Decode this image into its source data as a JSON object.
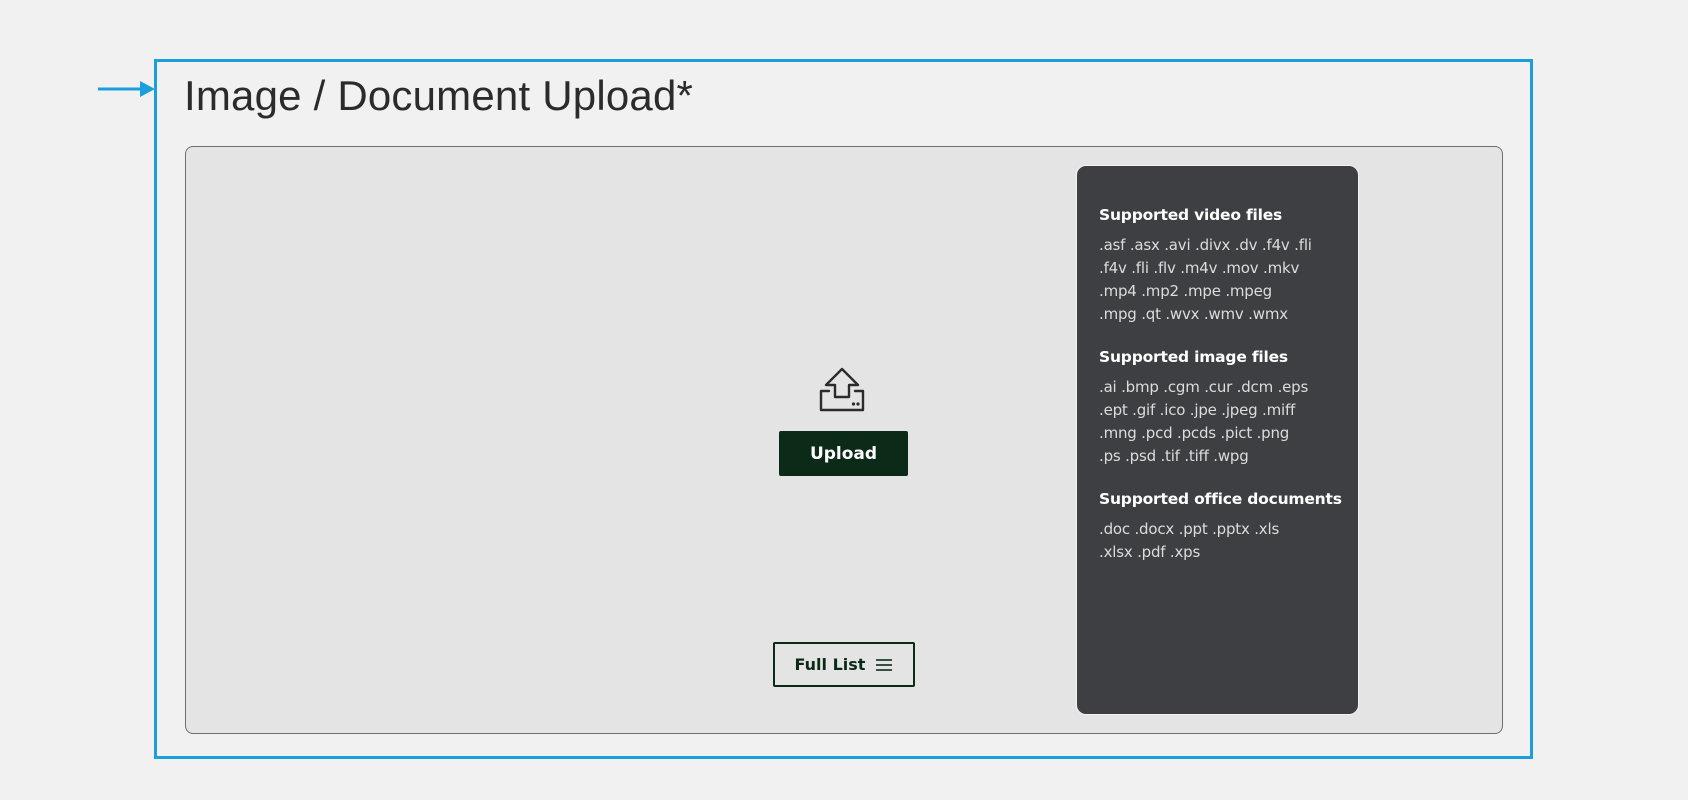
{
  "title": "Image / Document Upload*",
  "upload": {
    "button_label": "Upload",
    "icon": "upload-tray-icon"
  },
  "full_list": {
    "button_label": "Full List",
    "icon": "menu-lines-icon"
  },
  "supported": {
    "video": {
      "heading": "Supported video files",
      "lines": [
        ".asf  .asx  .avi  .divx  .dv  .f4v  .fli",
        ".f4v  .fli  .flv  .m4v  .mov  .mkv",
        ".mp4  .mp2  .mpe  .mpeg",
        ".mpg  .qt  .wvx  .wmv  .wmx"
      ]
    },
    "image": {
      "heading": "Supported image files",
      "lines": [
        ".ai  .bmp  .cgm  .cur  .dcm  .eps",
        ".ept  .gif  .ico  .jpe  .jpeg  .miff",
        ".mng  .pcd  .pcds  .pict  .png",
        ".ps  .psd  .tif  .tiff  .wpg"
      ]
    },
    "office": {
      "heading": "Supported office documents",
      "lines": [
        ".doc  .docx  .ppt  .pptx  .xls",
        ".xlsx  .pdf  .xps"
      ]
    }
  },
  "colors": {
    "frame_accent": "#1a9fdc",
    "primary_button": "#0b2a18",
    "panel_bg": "#3e3f42",
    "dropzone_bg": "#e4e4e4",
    "page_bg": "#f1f1f1"
  }
}
